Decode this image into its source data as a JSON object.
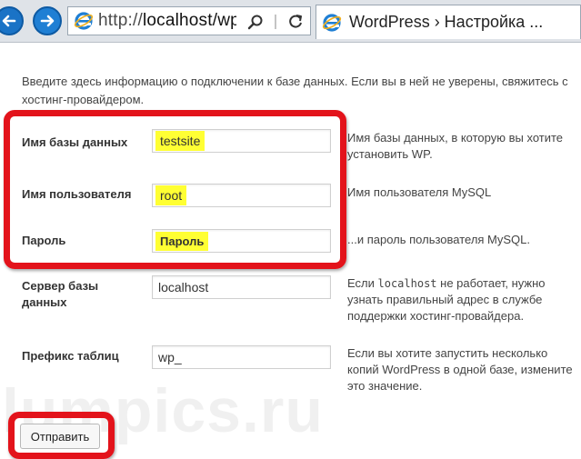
{
  "browser": {
    "address_url": "http://localhost/wp",
    "address_scheme": "http://",
    "address_host": "localhost/wp",
    "tab_title": "WordPress › Настройка ..."
  },
  "form": {
    "intro": "Введите здесь информацию о подключении к базе данных. Если вы в ней не уверены, свяжитесь с хостинг-провайдером.",
    "fields": [
      {
        "label": "Имя базы данных",
        "value": "testsite",
        "help": "Имя базы данных, в которую вы хотите установить WP."
      },
      {
        "label": "Имя пользователя",
        "value": "root",
        "help": "Имя пользователя MySQL"
      },
      {
        "label": "Пароль",
        "value": "Пароль",
        "help": "...и пароль пользователя MySQL."
      },
      {
        "label": "Сервер базы данных",
        "value": "localhost",
        "help_pre": "Если",
        "help_code": "localhost",
        "help_post": "не работает, нужно узнать правильный адрес в службе поддержки хостинг-провайдера."
      },
      {
        "label": "Префикс таблиц",
        "value": "wp_",
        "help": "Если вы хотите запустить несколько копий WordPress в одной базе, измените это значение."
      }
    ],
    "submit_label": "Отправить"
  },
  "watermark": "lumpics.ru",
  "colors": {
    "highlight": "#ffff33",
    "annotation_red": "#e3131b",
    "ie_blue": "#1f7fd4"
  }
}
